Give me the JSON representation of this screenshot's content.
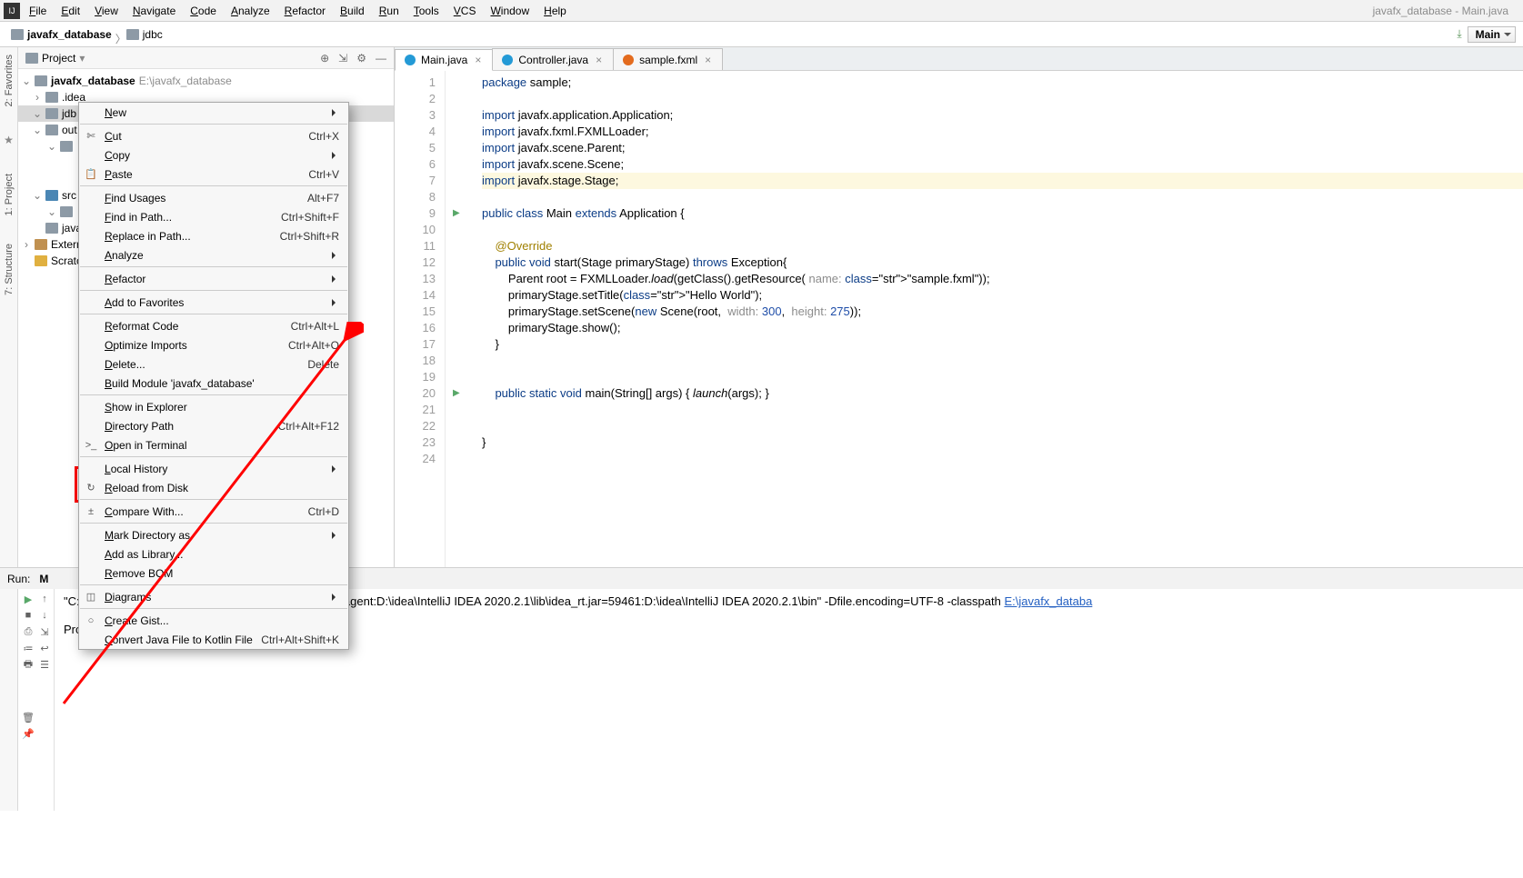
{
  "menubar": {
    "items": [
      "File",
      "Edit",
      "View",
      "Navigate",
      "Code",
      "Analyze",
      "Refactor",
      "Build",
      "Run",
      "Tools",
      "VCS",
      "Window",
      "Help"
    ],
    "title": "javafx_database - Main.java"
  },
  "breadcrumb": {
    "root": "javafx_database",
    "child": "jdbc",
    "combo": "Main"
  },
  "sideTabs": [
    "2: Favorites",
    "1: Project",
    "7: Structure"
  ],
  "projectPanel": {
    "title": "Project",
    "tree": [
      {
        "indent": 0,
        "chev": "v",
        "icon": "folder",
        "label": "javafx_database",
        "path": "E:\\javafx_database"
      },
      {
        "indent": 1,
        "chev": ">",
        "icon": "folder",
        "label": ".idea"
      },
      {
        "indent": 1,
        "chev": "v",
        "icon": "folder",
        "label": "jdb",
        "sel": true
      },
      {
        "indent": 1,
        "chev": "v",
        "icon": "folder",
        "label": "out"
      },
      {
        "indent": 2,
        "chev": "v",
        "icon": "folder",
        "label": ""
      },
      {
        "indent": 3,
        "chev": "",
        "icon": "",
        "label": ""
      },
      {
        "indent": 3,
        "chev": "",
        "icon": "",
        "label": ""
      },
      {
        "indent": 1,
        "chev": "v",
        "icon": "folder-blue",
        "label": "src"
      },
      {
        "indent": 2,
        "chev": "v",
        "icon": "folder",
        "label": ""
      },
      {
        "indent": 1,
        "chev": "",
        "icon": "folder",
        "label": "java"
      },
      {
        "indent": 0,
        "chev": ">",
        "icon": "lib",
        "label": "Extern"
      },
      {
        "indent": 0,
        "chev": "",
        "icon": "scratch",
        "label": "Scratc"
      }
    ]
  },
  "contextMenu": {
    "items": [
      {
        "label": "New",
        "sub": true
      },
      {
        "sep": true
      },
      {
        "icon": "✄",
        "label": "Cut",
        "sc": "Ctrl+X"
      },
      {
        "label": "Copy",
        "sub": true
      },
      {
        "icon": "📋",
        "label": "Paste",
        "sc": "Ctrl+V"
      },
      {
        "sep": true
      },
      {
        "label": "Find Usages",
        "sc": "Alt+F7"
      },
      {
        "label": "Find in Path...",
        "sc": "Ctrl+Shift+F"
      },
      {
        "label": "Replace in Path...",
        "sc": "Ctrl+Shift+R"
      },
      {
        "label": "Analyze",
        "sub": true
      },
      {
        "sep": true
      },
      {
        "label": "Refactor",
        "sub": true
      },
      {
        "sep": true
      },
      {
        "label": "Add to Favorites",
        "sub": true
      },
      {
        "sep": true
      },
      {
        "label": "Reformat Code",
        "sc": "Ctrl+Alt+L"
      },
      {
        "label": "Optimize Imports",
        "sc": "Ctrl+Alt+O"
      },
      {
        "label": "Delete...",
        "sc": "Delete"
      },
      {
        "label": "Build Module 'javafx_database'"
      },
      {
        "sep": true
      },
      {
        "label": "Show in Explorer"
      },
      {
        "label": "Directory Path",
        "sc": "Ctrl+Alt+F12"
      },
      {
        "icon": ">_",
        "label": "Open in Terminal"
      },
      {
        "sep": true
      },
      {
        "label": "Local History",
        "sub": true
      },
      {
        "icon": "↻",
        "label": "Reload from Disk"
      },
      {
        "sep": true
      },
      {
        "icon": "±",
        "label": "Compare With...",
        "sc": "Ctrl+D"
      },
      {
        "sep": true
      },
      {
        "label": "Mark Directory as",
        "sub": true
      },
      {
        "label": "Add as Library..."
      },
      {
        "label": "Remove BOM"
      },
      {
        "sep": true
      },
      {
        "icon": "◫",
        "label": "Diagrams",
        "sub": true
      },
      {
        "sep": true
      },
      {
        "icon": "○",
        "label": "Create Gist..."
      },
      {
        "label": "Convert Java File to Kotlin File",
        "sc": "Ctrl+Alt+Shift+K"
      }
    ]
  },
  "tabs": [
    {
      "icon": "java",
      "label": "Main.java",
      "active": true
    },
    {
      "icon": "java",
      "label": "Controller.java",
      "active": false
    },
    {
      "icon": "fxml",
      "label": "sample.fxml",
      "active": false
    }
  ],
  "code": {
    "lines": [
      {
        "n": 1,
        "t": "package sample;"
      },
      {
        "n": 2,
        "t": ""
      },
      {
        "n": 3,
        "t": "import javafx.application.Application;"
      },
      {
        "n": 4,
        "t": "import javafx.fxml.FXMLLoader;"
      },
      {
        "n": 5,
        "t": "import javafx.scene.Parent;"
      },
      {
        "n": 6,
        "t": "import javafx.scene.Scene;"
      },
      {
        "n": 7,
        "t": "import javafx.stage.Stage;",
        "hl": true
      },
      {
        "n": 8,
        "t": ""
      },
      {
        "n": 9,
        "t": "public class Main extends Application {",
        "run": true
      },
      {
        "n": 10,
        "t": ""
      },
      {
        "n": 11,
        "t": "    @Override"
      },
      {
        "n": 12,
        "t": "    public void start(Stage primaryStage) throws Exception{"
      },
      {
        "n": 13,
        "t": "        Parent root = FXMLLoader.load(getClass().getResource( name: \"sample.fxml\"));"
      },
      {
        "n": 14,
        "t": "        primaryStage.setTitle(\"Hello World\");"
      },
      {
        "n": 15,
        "t": "        primaryStage.setScene(new Scene(root,  width: 300,  height: 275));"
      },
      {
        "n": 16,
        "t": "        primaryStage.show();"
      },
      {
        "n": 17,
        "t": "    }"
      },
      {
        "n": 18,
        "t": ""
      },
      {
        "n": 19,
        "t": ""
      },
      {
        "n": 20,
        "t": "    public static void main(String[] args) { launch(args); }",
        "run": true
      },
      {
        "n": 21,
        "t": ""
      },
      {
        "n": 22,
        "t": ""
      },
      {
        "n": 23,
        "t": "}"
      },
      {
        "n": 24,
        "t": ""
      }
    ]
  },
  "run": {
    "label": "Run:",
    "config": "M",
    "out1": "\"C:\\Program Files\\Java\\jdk-10.0.1\\bin\\java.exe\" \"-javaagent:D:\\idea\\IntelliJ IDEA 2020.2.1\\lib\\idea_rt.jar=59461:D:\\idea\\IntelliJ IDEA 2020.2.1\\bin\" -Dfile.encoding=UTF-8 -classpath ",
    "link": "E:\\javafx_databa",
    "out2": "Process finished with exit code 0"
  }
}
